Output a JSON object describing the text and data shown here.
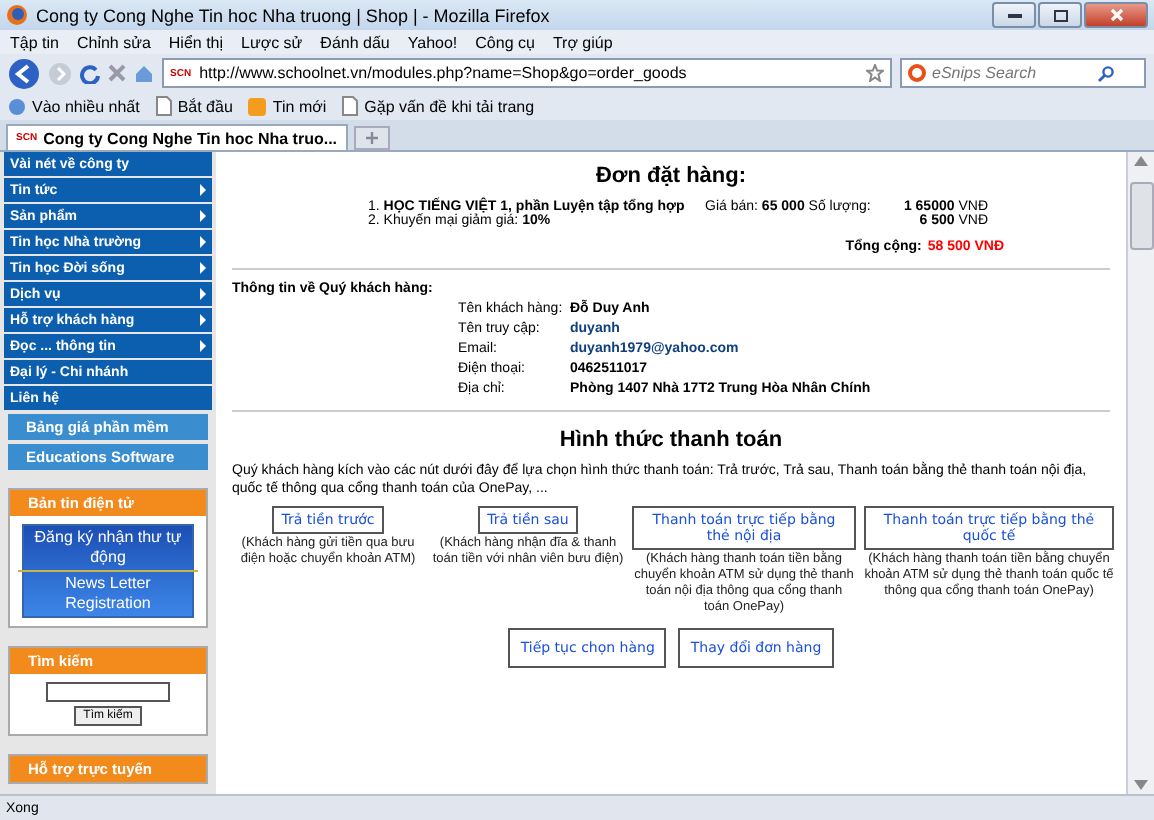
{
  "window": {
    "title": "Cong ty Cong Nghe Tin hoc Nha truong | Shop | - Mozilla Firefox"
  },
  "menu": [
    "Tập tin",
    "Chỉnh sửa",
    "Hiển thị",
    "Lược sử",
    "Đánh dấu",
    "Yahoo!",
    "Công cụ",
    "Trợ giúp"
  ],
  "navbar": {
    "url": "http://www.schoolnet.vn/modules.php?name=Shop&go=order_goods",
    "site_badge": "SCN",
    "search_placeholder": "eSnips Search"
  },
  "bookmarks": [
    {
      "label": "Vào nhiều nhất",
      "kind": "star"
    },
    {
      "label": "Bắt đầu",
      "kind": "page"
    },
    {
      "label": "Tin mới",
      "kind": "feed"
    },
    {
      "label": "Gặp vấn đề khi tải trang",
      "kind": "page"
    }
  ],
  "tabs": [
    {
      "label": "Cong ty Cong Nghe Tin hoc Nha truo...",
      "badge": "SCN",
      "selected": true
    }
  ],
  "sidebar": {
    "menu": [
      {
        "label": "Vài nét về công ty",
        "arrow": false
      },
      {
        "label": "Tin tức",
        "arrow": true
      },
      {
        "label": "Sản phẩm",
        "arrow": true
      },
      {
        "label": "Tin học Nhà trường",
        "arrow": true
      },
      {
        "label": "Tin học Đời sống",
        "arrow": true
      },
      {
        "label": "Dịch vụ",
        "arrow": true
      },
      {
        "label": "Hỗ trợ khách hàng",
        "arrow": true
      },
      {
        "label": "Đọc ... thông tin",
        "arrow": true
      },
      {
        "label": "Đại lý - Chi nhánh",
        "arrow": false
      },
      {
        "label": "Liên hệ",
        "arrow": false
      }
    ],
    "links": [
      "Bảng giá phần mềm",
      "Educations Software"
    ],
    "newsletter": {
      "title": "Bản tin điện tử",
      "banner_top": "Đăng ký nhận thư tự động",
      "banner_bottom": "News Letter Registration"
    },
    "search": {
      "title": "Tìm kiếm",
      "button": "Tìm kiếm"
    },
    "support": {
      "title": "Hỗ trợ trực tuyến"
    }
  },
  "order": {
    "title": "Đơn đặt hàng:",
    "lines": [
      {
        "kind": "product",
        "index": "1.",
        "name": "HỌC TIẾNG VIỆT 1, phần Luyện tập tổng hợp",
        "price_label": "Giá bán:",
        "price": "65 000",
        "qty_label": "Số lượng:",
        "amount": "1 65000",
        "currency": "VNĐ"
      },
      {
        "kind": "discount",
        "index": "2.",
        "label": "Khuyến mại giảm giá:",
        "value": "10%",
        "amount": "6 500",
        "currency": "VNĐ"
      }
    ],
    "total_label": "Tổng cộng:",
    "total": "58 500 VNĐ"
  },
  "customer": {
    "heading": "Thông tin về Quý khách hàng:",
    "fields": [
      {
        "label": "Tên khách hàng:",
        "value": "Đỗ Duy Anh",
        "kind": "plain"
      },
      {
        "label": "Tên truy cập:",
        "value": "duyanh",
        "kind": "link"
      },
      {
        "label": "Email:",
        "value": "duyanh1979@yahoo.com",
        "kind": "link"
      },
      {
        "label": "Điện thoại:",
        "value": "0462511017",
        "kind": "plain"
      },
      {
        "label": "Địa chỉ:",
        "value": "Phòng 1407 Nhà 17T2 Trung Hòa Nhân Chính",
        "kind": "plain"
      }
    ]
  },
  "payment": {
    "heading": "Hình thức thanh toán",
    "intro": "Quý khách hàng kích vào các nút dưới đây để lựa chọn hình thức thanh toán: Trả trước, Trả sau, Thanh toán bằng thẻ thanh toán nội địa, quốc tế thông qua cổng thanh toán của OnePay, ...",
    "options": [
      {
        "button": "Trả tiền trước",
        "note": "(Khách hàng gửi tiền qua bưu điện hoặc chuyển khoản ATM)"
      },
      {
        "button": "Trả tiền sau",
        "note": "(Khách hàng nhận đĩa & thanh toán tiền với nhân viên bưu điện)"
      },
      {
        "button": "Thanh toán trực tiếp bằng thẻ nội địa",
        "note": "(Khách hàng thanh toán tiền bằng chuyển khoản ATM sử dụng thẻ thanh toán nội địa thông qua cổng thanh toán OnePay)"
      },
      {
        "button": "Thanh toán trực tiếp bằng thẻ quốc tế",
        "note": "(Khách hàng thanh toán tiền bằng chuyển khoản ATM sử dụng thẻ thanh toán quốc tế thông qua cổng thanh toán OnePay)"
      }
    ],
    "actions": [
      "Tiếp tục chọn hàng",
      "Thay đổi đơn hàng"
    ]
  },
  "status_bar": {
    "text": "Xong"
  }
}
